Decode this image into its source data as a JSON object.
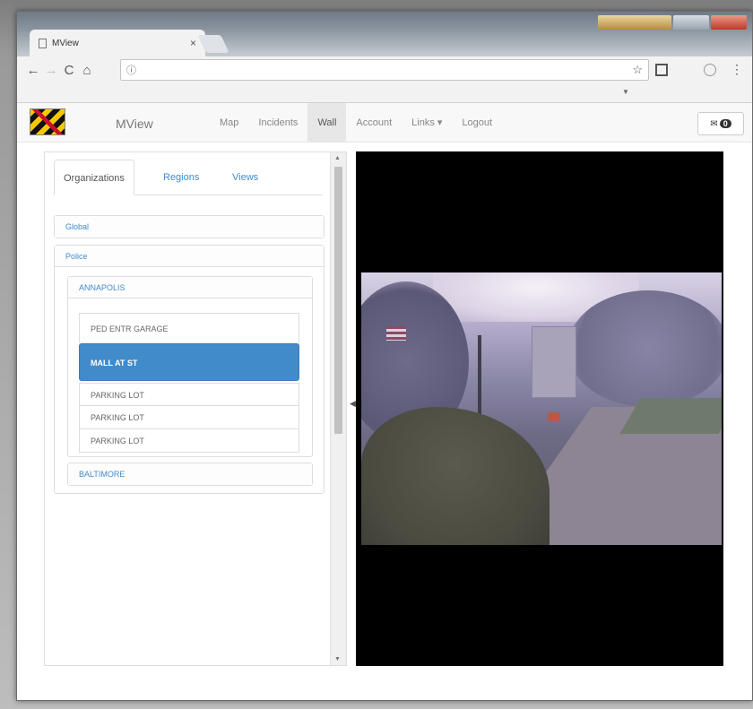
{
  "browser": {
    "tab_title": "MView",
    "tab_close": "×",
    "address_text": "ⓘ",
    "nav": {
      "back": "←",
      "forward": "→",
      "reload": "C",
      "home": "⌂"
    },
    "bookmark_star": "☆",
    "menu": "⋮",
    "subbar_dropdown": "▼"
  },
  "app": {
    "brand": "MView",
    "nav_links": [
      {
        "label": "Map"
      },
      {
        "label": "Incidents"
      },
      {
        "label": "Wall",
        "active": true
      },
      {
        "label": "Account"
      },
      {
        "label": "Links ▾"
      },
      {
        "label": "Logout"
      }
    ],
    "messages": {
      "icon": "envelope-icon",
      "glyph": "✉",
      "count": "0"
    }
  },
  "left_panel": {
    "tabs": [
      {
        "label": "Organizations",
        "active": true
      },
      {
        "label": "Regions"
      },
      {
        "label": "Views"
      }
    ],
    "groups": {
      "global": "Global",
      "police": "Police",
      "annapolis": "ANNAPOLIS",
      "baltimore": "BALTIMORE"
    },
    "cameras": [
      {
        "label": "PED ENTR GARAGE"
      },
      {
        "label": "MALL AT ST",
        "selected": true
      },
      {
        "label": "PARKING LOT"
      },
      {
        "label": "PARKING LOT"
      },
      {
        "label": "PARKING LOT"
      }
    ],
    "scroll": {
      "up": "▲",
      "down": "▼"
    }
  },
  "splitter_glyph": "◀",
  "colors": {
    "accent": "#428bca",
    "video_bg": "#000000"
  }
}
